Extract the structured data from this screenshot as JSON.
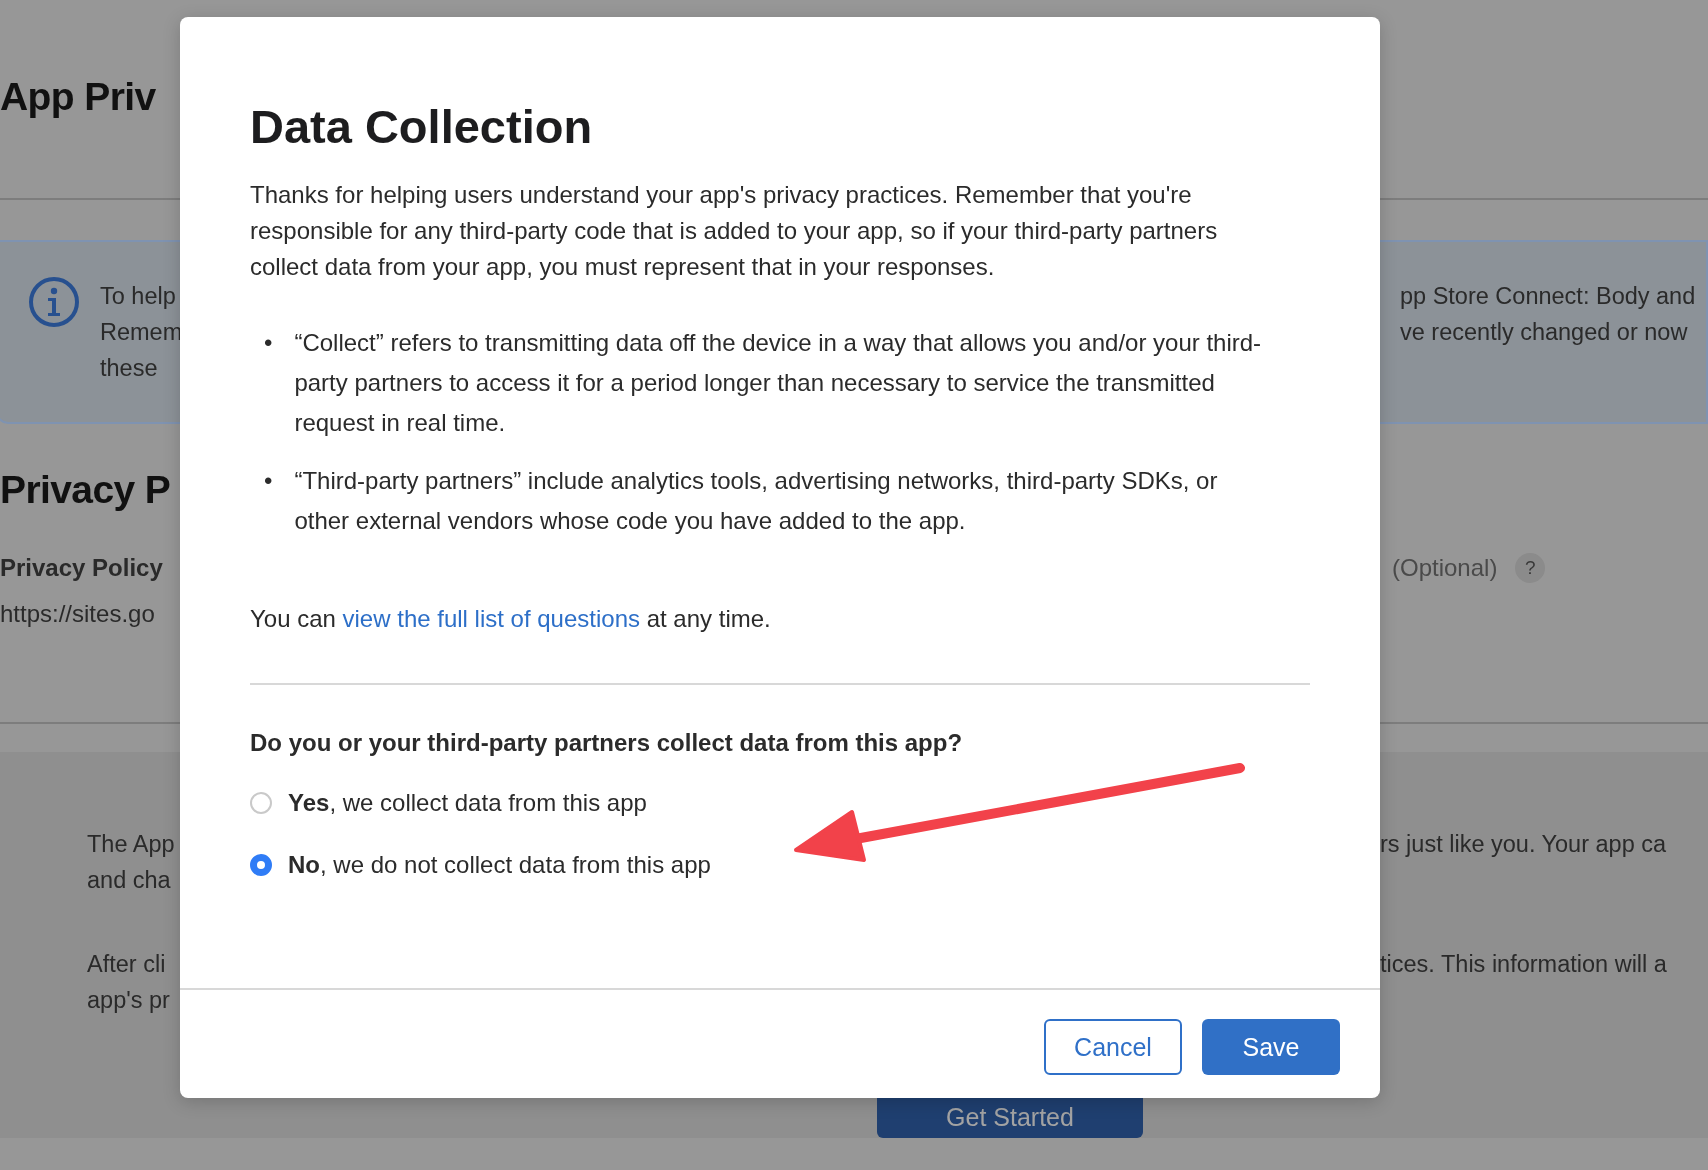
{
  "background_page": {
    "title": "App Priv",
    "notice": {
      "lines_left": [
        "To help",
        "Remem",
        "these"
      ],
      "lines_right": [
        "pp Store Connect: Body and",
        "ve recently changed or now"
      ]
    },
    "section_title": "Privacy P",
    "field_label": "Privacy Policy",
    "field_label_right": "(Optional)",
    "help_button": "?",
    "field_value": "https://sites.go",
    "intro_left": [
      [
        "The App",
        "and cha"
      ],
      [
        "After cli",
        "app's pr"
      ]
    ],
    "intro_right": [
      "rs just like you. Your app ca",
      "tices. This information will a"
    ],
    "get_started_button": "Get Started"
  },
  "dialog": {
    "title": "Data Collection",
    "intro": "Thanks for helping users understand your app's privacy practices. Remember that you're responsible for any third-party code that is added to your app, so if your third-party partners collect data from your app, you must represent that in your responses.",
    "bullet_marker": "•",
    "bullets": [
      "“Collect” refers to transmitting data off the device in a way that allows you and/or your third-party partners to access it for a period longer than necessary to service the transmitted request in real time.",
      "“Third-party partners” include analytics tools, advertising networks, third-party SDKs, or other external vendors whose code you have added to the app."
    ],
    "questions_note": {
      "before": "You can ",
      "link": "view the full list of questions",
      "after": " at any time."
    },
    "question": "Do you or your third-party partners collect data from this app?",
    "options": [
      {
        "label": "**Yes**, we collect data from this app",
        "selected": false
      },
      {
        "label": "**No**, we do not collect data from this app",
        "selected": true
      }
    ],
    "buttons": [
      {
        "label": "Cancel",
        "kind": "secondary"
      },
      {
        "label": "Save",
        "kind": "primary"
      }
    ]
  }
}
